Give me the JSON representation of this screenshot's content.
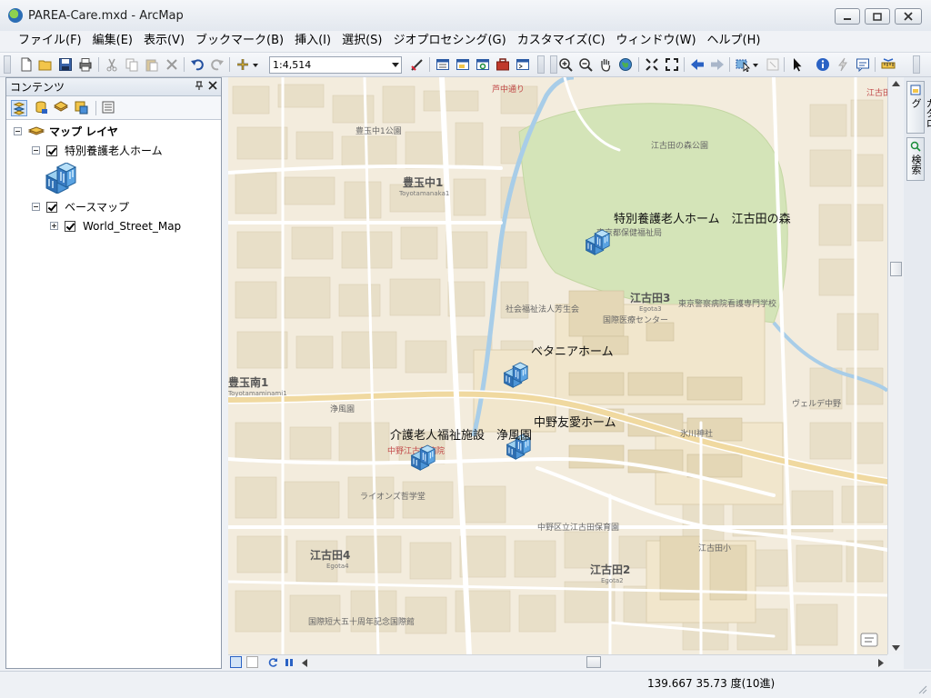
{
  "window": {
    "title": "PAREA-Care.mxd - ArcMap"
  },
  "menu": [
    "ファイル(F)",
    "編集(E)",
    "表示(V)",
    "ブックマーク(B)",
    "挿入(I)",
    "選択(S)",
    "ジオプロセシング(G)",
    "カスタマイズ(C)",
    "ウィンドウ(W)",
    "ヘルプ(H)"
  ],
  "toolbar": {
    "scale": "1:4,514"
  },
  "toc": {
    "title": "コンテンツ",
    "pin_glyph": "ㅁ",
    "close_glyph": "×",
    "root_label": "マップ レイヤ",
    "layers": [
      {
        "label": "特別養護老人ホーム"
      },
      {
        "label": "ベースマップ"
      },
      {
        "label": "World_Street_Map"
      }
    ]
  },
  "map": {
    "facilities": [
      "特別養護老人ホーム　江古田の森",
      "ベタニアホーム",
      "中野友愛ホーム",
      "介護老人福祉施設　浄風園"
    ],
    "districts": [
      {
        "name": "豊玉中1",
        "roman": "Toyotamanaka1"
      },
      {
        "name": "江古田3",
        "roman": "Egota3"
      },
      {
        "name": "豊玉南1",
        "roman": "Toyotamaminami1"
      },
      {
        "name": "江古田4",
        "roman": "Egota4"
      },
      {
        "name": "江古田2",
        "roman": "Egota2"
      }
    ],
    "place_labels": [
      "江古田の森公園",
      "東京警察病院看護専門学校",
      "国際医療センター",
      "江古田小",
      "中野江古田病院",
      "氷川神社",
      "豊玉中1公園",
      "ライオンズ哲学堂",
      "国際短大五十周年記念国際館",
      "芦中通り",
      "東京都保健福祉局",
      "社会福祉法人芳生会",
      "江古田1",
      "ヴェルデ中野",
      "浄風園",
      "中野区立江古田保育園"
    ]
  },
  "status": {
    "coords": "139.667  35.73 度(10進)"
  },
  "dock": {
    "catalog": "カタログ",
    "search": "検索"
  },
  "colors": {
    "map_bg": "#f3ecdd",
    "park": "#d4e4b8",
    "block": "#e8dfc8",
    "water": "#a8cde8",
    "road": "#ffffff",
    "facility_icon": "#2f6fb4"
  }
}
